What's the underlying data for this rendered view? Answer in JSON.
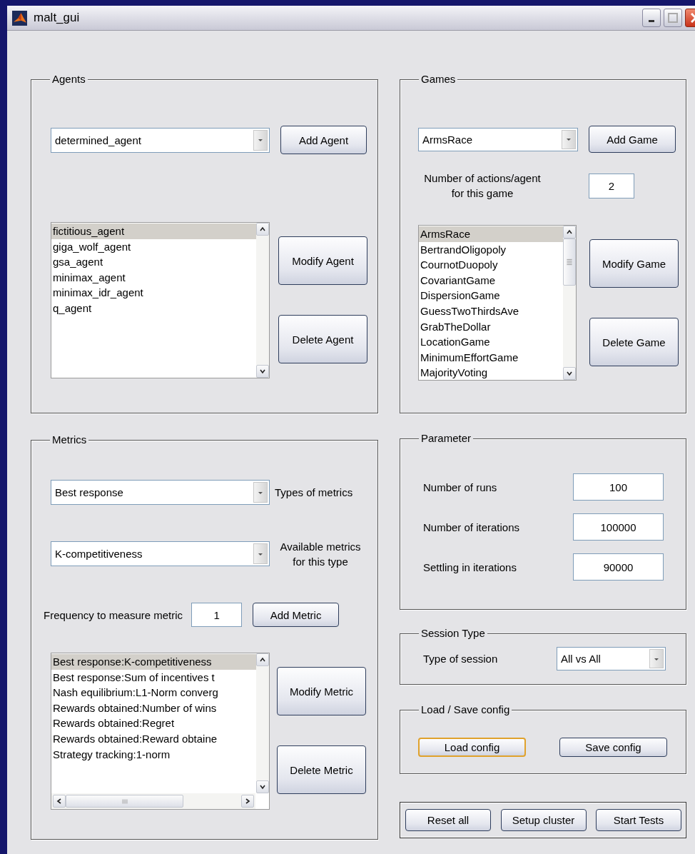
{
  "window": {
    "title": "malt_gui"
  },
  "agents": {
    "title": "Agents",
    "agent_type": {
      "value": "determined_agent"
    },
    "add_button": "Add Agent",
    "list": [
      {
        "label": "fictitious_agent",
        "selected": true
      },
      {
        "label": "giga_wolf_agent",
        "selected": false
      },
      {
        "label": "gsa_agent",
        "selected": false
      },
      {
        "label": "minimax_agent",
        "selected": false
      },
      {
        "label": "minimax_idr_agent",
        "selected": false
      },
      {
        "label": "q_agent",
        "selected": false
      }
    ],
    "modify_button": "Modify Agent",
    "delete_button": "Delete Agent"
  },
  "games": {
    "title": "Games",
    "game_type": {
      "value": "ArmsRace"
    },
    "add_button": "Add Game",
    "actions_label": "Number of actions/agent for this game",
    "actions_value": "2",
    "list": [
      {
        "label": "ArmsRace",
        "selected": true
      },
      {
        "label": "BertrandOligopoly",
        "selected": false
      },
      {
        "label": "CournotDuopoly",
        "selected": false
      },
      {
        "label": "CovariantGame",
        "selected": false
      },
      {
        "label": "DispersionGame",
        "selected": false
      },
      {
        "label": "GuessTwoThirdsAve",
        "selected": false
      },
      {
        "label": "GrabTheDollar",
        "selected": false
      },
      {
        "label": "LocationGame",
        "selected": false
      },
      {
        "label": "MinimumEffortGame",
        "selected": false
      },
      {
        "label": "MajorityVoting",
        "selected": false
      }
    ],
    "modify_button": "Modify Game",
    "delete_button": "Delete Game"
  },
  "metrics": {
    "title": "Metrics",
    "metric_type": {
      "value": "Best response",
      "label": "Types of metrics"
    },
    "available_metric": {
      "value": "K-competitiveness",
      "label": "Available metrics for this type"
    },
    "frequency_label": "Frequency to measure metric",
    "frequency_value": "1",
    "add_button": "Add Metric",
    "list": [
      {
        "label": "Best response:K-competitiveness",
        "selected": true
      },
      {
        "label": "Best response:Sum of incentives t",
        "selected": false
      },
      {
        "label": "Nash equilibrium:L1-Norm converg",
        "selected": false
      },
      {
        "label": "Rewards obtained:Number of wins",
        "selected": false
      },
      {
        "label": "Rewards obtained:Regret",
        "selected": false
      },
      {
        "label": "Rewards obtained:Reward obtaine",
        "selected": false
      },
      {
        "label": "Strategy tracking:1-norm",
        "selected": false
      }
    ],
    "modify_button": "Modify Metric",
    "delete_button": "Delete Metric"
  },
  "parameter": {
    "title": "Parameter",
    "fields": [
      {
        "label": "Number of runs",
        "value": "100"
      },
      {
        "label": "Number of iterations",
        "value": "100000"
      },
      {
        "label": "Settling in iterations",
        "value": "90000"
      }
    ]
  },
  "session_type": {
    "title": "Session Type",
    "label": "Type of session",
    "value": "All vs All"
  },
  "config": {
    "title": "Load / Save config",
    "buttons": [
      {
        "label": "Load config",
        "focused": true
      },
      {
        "label": "Save config",
        "focused": false
      }
    ]
  },
  "actions": {
    "buttons": [
      "Reset all",
      "Setup cluster",
      "Start Tests"
    ]
  }
}
